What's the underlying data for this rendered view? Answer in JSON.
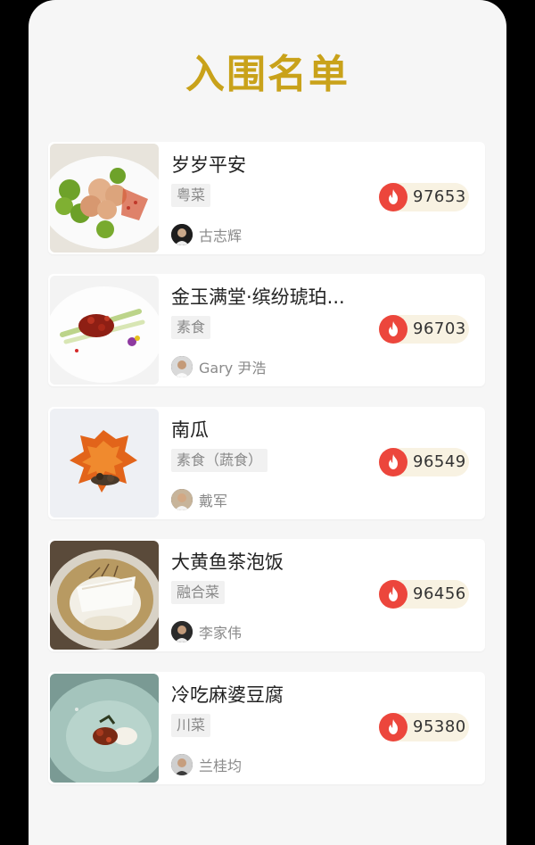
{
  "page": {
    "title": "入围名单",
    "accent_color": "#c9a21a",
    "vote_icon_color": "#ec463c"
  },
  "entries": [
    {
      "dish": "岁岁平安",
      "category": "粤菜",
      "chef": "古志辉",
      "votes": "97653",
      "image": "dish-photo-romanesco-and-meat",
      "avatar": "chef-avatar"
    },
    {
      "dish": "金玉满堂·缤纷琥珀...",
      "category": "素食",
      "chef": "Gary 尹浩",
      "votes": "96703",
      "image": "dish-photo-amber-jelly",
      "avatar": "chef-avatar"
    },
    {
      "dish": "南瓜",
      "category": "素食（蔬食）",
      "chef": "戴军",
      "votes": "96549",
      "image": "dish-photo-pumpkin",
      "avatar": "chef-avatar"
    },
    {
      "dish": "大黄鱼茶泡饭",
      "category": "融合菜",
      "chef": "李家伟",
      "votes": "96456",
      "image": "dish-photo-fish-rice",
      "avatar": "chef-avatar"
    },
    {
      "dish": "冷吃麻婆豆腐",
      "category": "川菜",
      "chef": "兰桂均",
      "votes": "95380",
      "image": "dish-photo-mapo-tofu",
      "avatar": "chef-avatar"
    }
  ]
}
